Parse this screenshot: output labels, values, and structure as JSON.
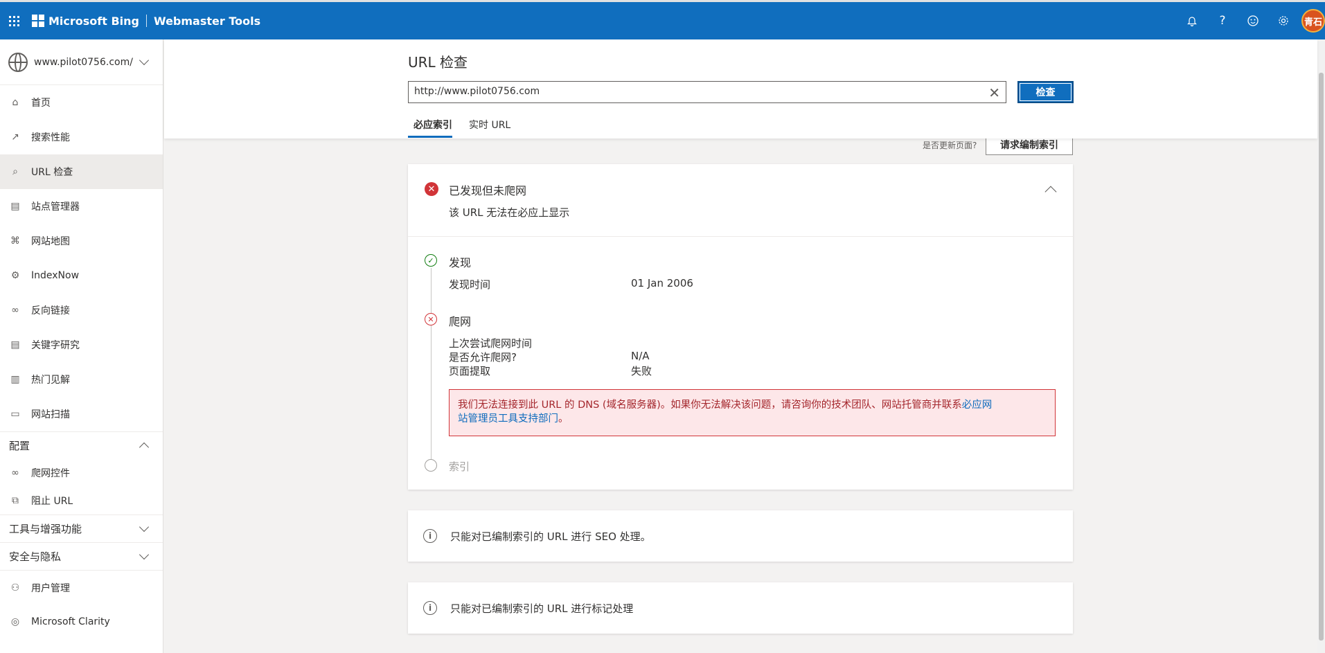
{
  "topbar": {
    "brand": "Microsoft Bing",
    "product": "Webmaster Tools",
    "avatar_text": "青石",
    "icons": [
      "bell-icon",
      "help-icon",
      "feedback-smiley-icon",
      "gear-icon"
    ]
  },
  "sidebar": {
    "site": "www.pilot0756.com/",
    "items": [
      {
        "label": "首页",
        "icon": "home-icon"
      },
      {
        "label": "搜索性能",
        "icon": "trend-icon"
      },
      {
        "label": "URL 检查",
        "icon": "search-icon",
        "active": true
      },
      {
        "label": "站点管理器",
        "icon": "list-icon"
      },
      {
        "label": "网站地图",
        "icon": "sitemap-icon"
      },
      {
        "label": "IndexNow",
        "icon": "gear-icon"
      },
      {
        "label": "反向链接",
        "icon": "link-icon"
      },
      {
        "label": "关键字研究",
        "icon": "document-icon"
      },
      {
        "label": "热门见解",
        "icon": "insight-icon"
      },
      {
        "label": "网站扫描",
        "icon": "scan-icon"
      }
    ],
    "config_section": "配置",
    "config_items": [
      {
        "label": "爬网控件",
        "icon": "link-icon"
      },
      {
        "label": "阻止 URL",
        "icon": "block-icon"
      }
    ],
    "tools_section": "工具与增强功能",
    "security_section": "安全与隐私",
    "bottom_items": [
      {
        "label": "用户管理",
        "icon": "user-icon"
      },
      {
        "label": "Microsoft Clarity",
        "icon": "clarity-icon"
      }
    ]
  },
  "main": {
    "title": "URL 检查",
    "url_value": "http://www.pilot0756.com",
    "inspect_label": "检查",
    "tabs": [
      {
        "label": "必应索引",
        "active": true
      },
      {
        "label": "实时 URL"
      }
    ],
    "request_prompt": "是否更新页面?",
    "request_button": "请求编制索引",
    "status_title": "已发现但未爬网",
    "status_subtitle": "该 URL 无法在必应上显示",
    "discovery": {
      "title": "发现",
      "label": "发现时间",
      "value": "01 Jan 2006"
    },
    "crawl": {
      "title": "爬网",
      "last_attempt_label": "上次尝试爬网时间",
      "allowed_label": "是否允许爬网?",
      "allowed_value": "N/A",
      "fetch_label": "页面提取",
      "fetch_value": "失败",
      "error_text": "我们无法连接到此 URL 的 DNS (域名服务器)。如果你无法解决该问题，请咨询你的技术团队、网站托管商并联系",
      "error_link1": "必应网",
      "error_link2": "站管理员工具支持部门",
      "error_end": "。"
    },
    "index_title": "索引",
    "info1": "只能对已编制索引的 URL 进行 SEO 处理。",
    "info2": "只能对已编制索引的 URL 进行标记处理"
  }
}
